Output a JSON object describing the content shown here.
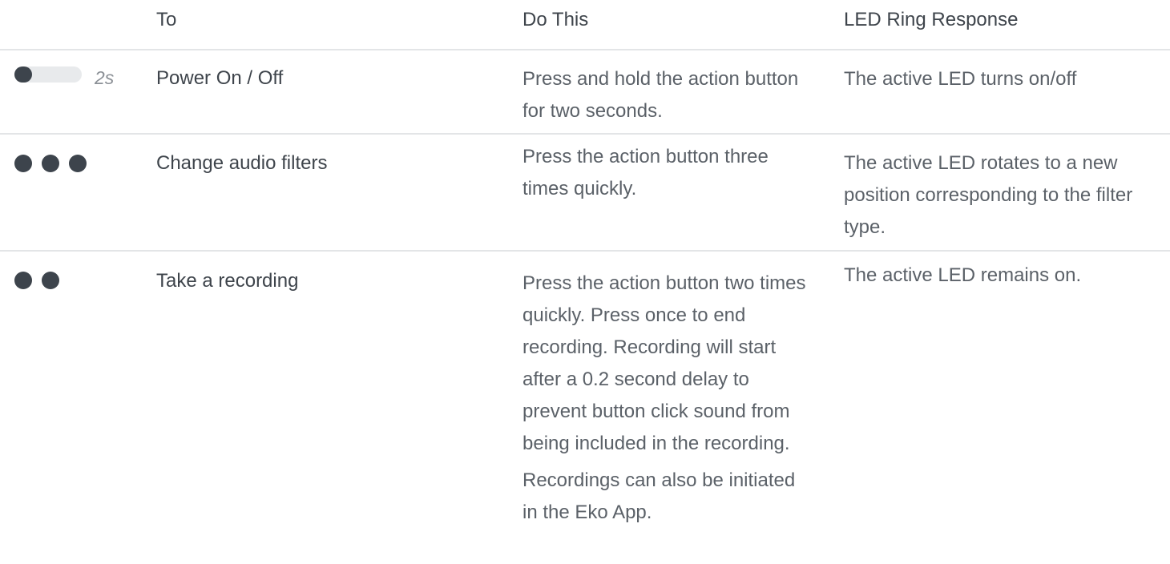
{
  "header": {
    "to": "To",
    "do_this": "Do This",
    "led_response": "LED Ring Response"
  },
  "rows": [
    {
      "indicator": "hold",
      "indicator_label": "2s",
      "to": "Power On / Off",
      "do_this": [
        "Press and hold the action button for two seconds."
      ],
      "led_response": "The active LED turns on/off"
    },
    {
      "indicator": "three-presses",
      "indicator_count": 3,
      "to": "Change audio filters",
      "do_this": [
        "Press the action button three times quickly."
      ],
      "led_response": "The active LED rotates to a new position corresponding to the filter type."
    },
    {
      "indicator": "two-presses",
      "indicator_count": 2,
      "to": "Take a recording",
      "do_this": [
        "Press the action button two times quickly.  Press once to end recording. Recording will start after a 0.2 second delay to prevent button click sound from being included in the recording.",
        "Recordings can also be initiated in the Eko App."
      ],
      "led_response": "The active LED remains on."
    }
  ],
  "colors": {
    "text": "#5b6168",
    "heading": "#3e444b",
    "dot": "#3d444c",
    "divider": "#e3e5e7",
    "track": "#e8eaec",
    "muted": "#8b9096"
  }
}
